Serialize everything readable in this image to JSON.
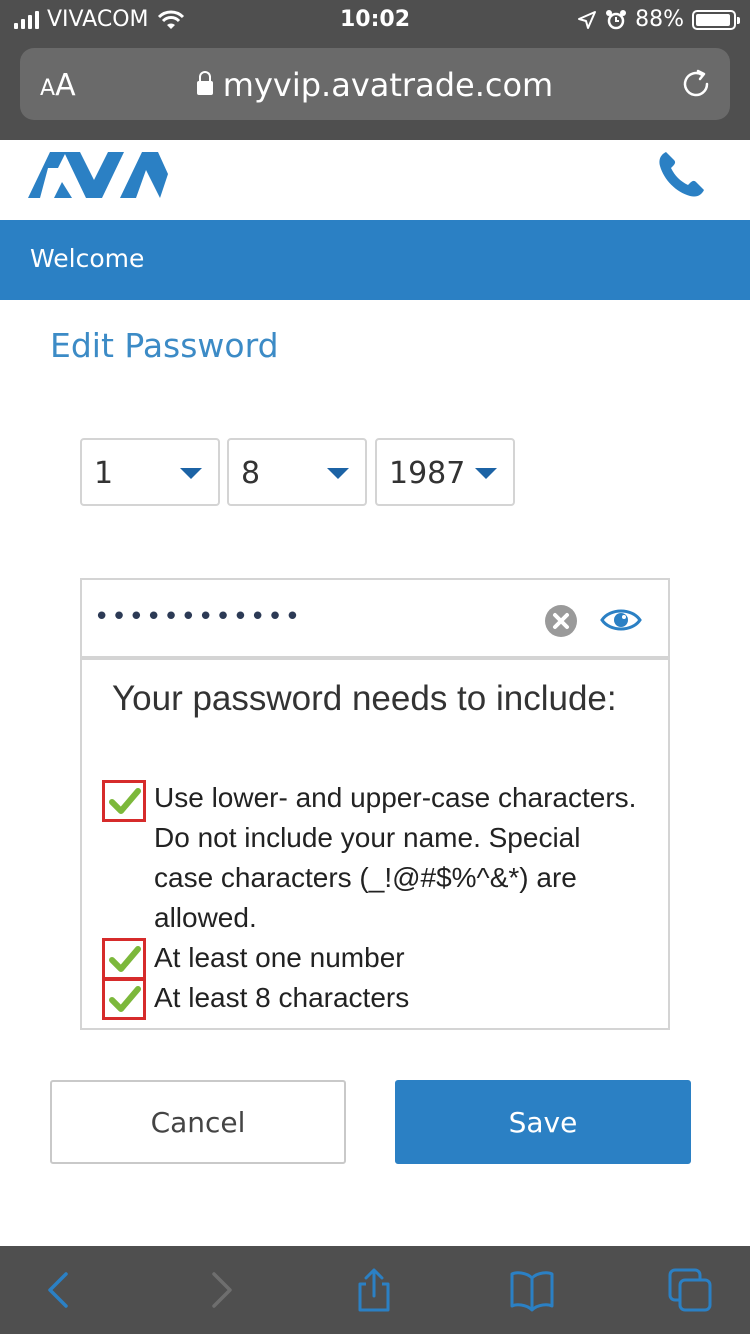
{
  "status_bar": {
    "carrier": "VIVACOM",
    "time": "10:02",
    "battery_percent": "88%",
    "battery_level": 0.88,
    "icons": [
      "signal-icon",
      "wifi-icon",
      "location-icon",
      "alarm-icon",
      "battery-icon"
    ]
  },
  "browser": {
    "text_size_label_small": "A",
    "text_size_label_large": "A",
    "url": "myvip.avatrade.com",
    "icons": [
      "lock-icon",
      "reload-icon"
    ]
  },
  "site_header": {
    "logo_text": "AVA",
    "phone_icon": "phone-icon",
    "welcome_text": "Welcome"
  },
  "page": {
    "title": "Edit Password"
  },
  "birthdate": {
    "day": "1",
    "month": "8",
    "year": "1987"
  },
  "password": {
    "masked_value": "••••••••••••",
    "icons": [
      "clear-icon",
      "eye-icon"
    ]
  },
  "requirements": {
    "title": "Your password needs to include:",
    "items": [
      {
        "text": "Use lower- and upper-case characters. Do not include your name. Special case characters (_!@#$%^&*) are allowed.",
        "met": true
      },
      {
        "text": "At least one number",
        "met": true
      },
      {
        "text": "At least 8 characters",
        "met": true
      }
    ]
  },
  "actions": {
    "cancel_label": "Cancel",
    "save_label": "Save"
  },
  "toolbar": {
    "icons": [
      "back-icon",
      "forward-icon",
      "share-icon",
      "bookmarks-icon",
      "tabs-icon"
    ]
  },
  "colors": {
    "brand_blue": "#2b80c4",
    "title_blue": "#3c8bc6",
    "check_green": "#7cb83b",
    "highlight_red": "#d62b2b",
    "chrome_gray": "#4f4f4f"
  }
}
